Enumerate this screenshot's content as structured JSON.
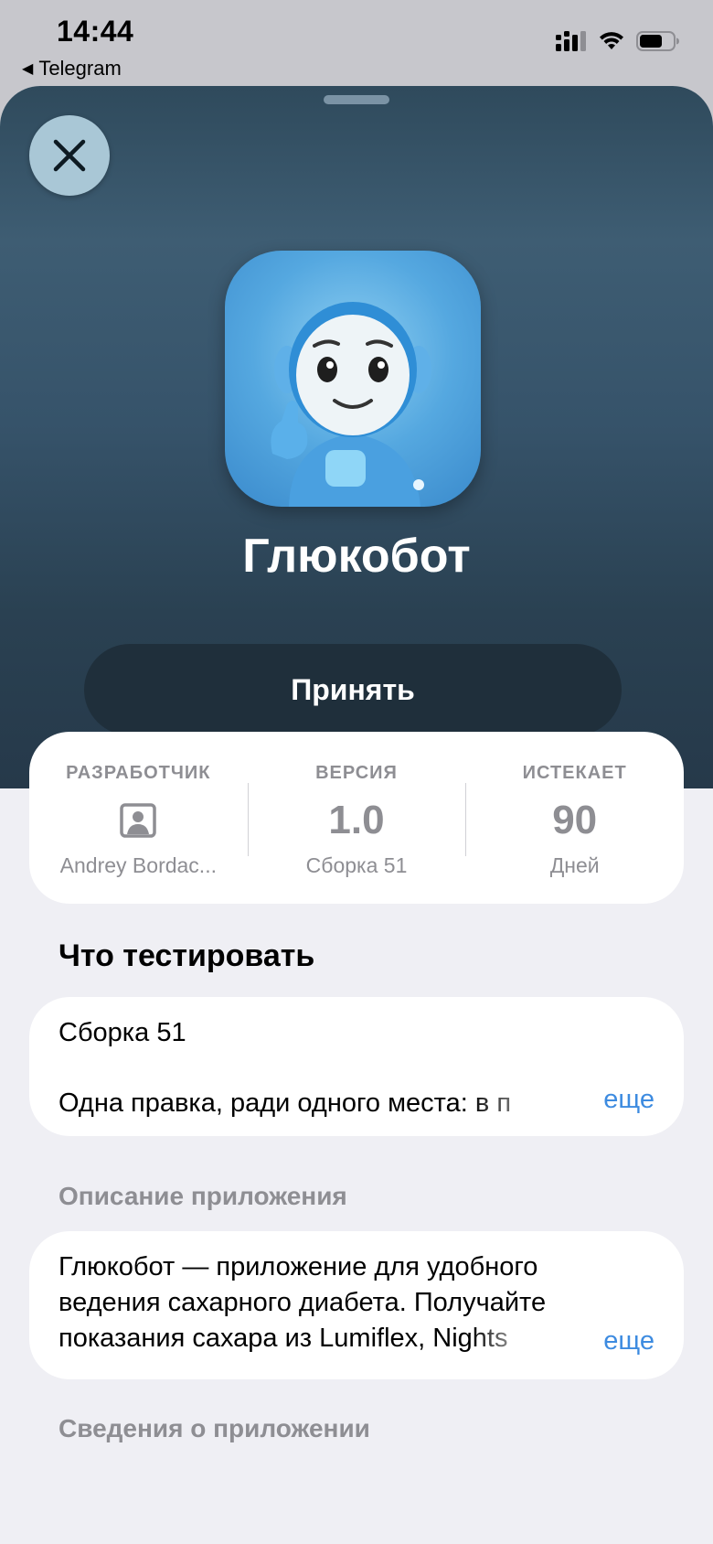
{
  "status_bar": {
    "time": "14:44",
    "back_app": "Telegram"
  },
  "app": {
    "name": "Глюкобот",
    "accept_label": "Принять"
  },
  "info": {
    "developer": {
      "label": "РАЗРАБОТЧИК",
      "name": "Andrey Bordac..."
    },
    "version": {
      "label": "ВЕРСИЯ",
      "value": "1.0",
      "sub": "Сборка 51"
    },
    "expires": {
      "label": "ИСТЕКАЕТ",
      "value": "90",
      "sub": "Дней"
    }
  },
  "what_to_test": {
    "title": "Что тестировать",
    "line1": "Сборка 51",
    "line2": "Одна правка, ради одного места: в п",
    "more": "еще"
  },
  "description": {
    "title": "Описание приложения",
    "lines": [
      "Глюкобот — приложение для удобного",
      "ведения сахарного диабета. Получайте",
      "показания сахара из Lumiflex, Nights"
    ],
    "more": "еще"
  },
  "app_info": {
    "title": "Сведения о приложении"
  },
  "colors": {
    "accent": "#3d8be0",
    "hero_top": "#3e5d73",
    "button_dark": "#1f2f3b"
  }
}
